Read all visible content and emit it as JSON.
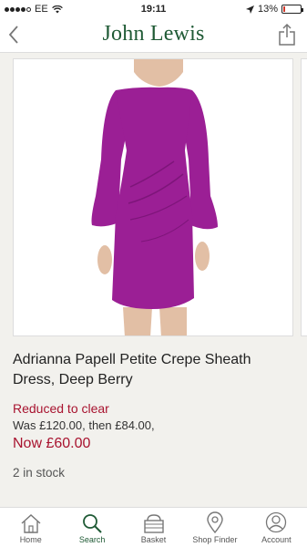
{
  "status_bar": {
    "carrier": "EE",
    "time": "19:11",
    "battery_percent": "13%",
    "battery_level": 0.13
  },
  "header": {
    "brand": "John Lewis",
    "back_icon": "chevron-left-icon",
    "share_icon": "share-icon"
  },
  "product": {
    "title": "Adrianna Papell Petite Crepe Sheath Dress, Deep Berry",
    "reduced_label": "Reduced to clear",
    "was_price_text": "Was £120.00, then £84.00,",
    "now_price_text": "Now £60.00",
    "stock_text": "2 in stock",
    "dress_color": "#9b1f95"
  },
  "tabs": [
    {
      "label": "Home",
      "icon": "home-icon"
    },
    {
      "label": "Search",
      "icon": "search-icon",
      "active": true
    },
    {
      "label": "Basket",
      "icon": "basket-icon"
    },
    {
      "label": "Shop Finder",
      "icon": "location-pin-icon"
    },
    {
      "label": "Account",
      "icon": "account-icon"
    }
  ],
  "colors": {
    "brand_green": "#1f5a35",
    "price_red": "#a8132f"
  }
}
